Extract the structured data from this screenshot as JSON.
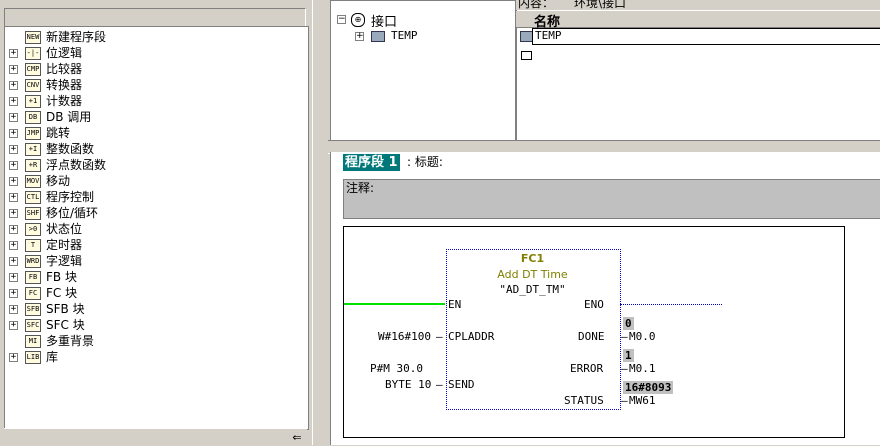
{
  "tree": {
    "items": [
      {
        "label": "新建程序段",
        "icon": "new-network-icon",
        "glyph": "NEW",
        "expandable": false
      },
      {
        "label": "位逻辑",
        "icon": "bit-logic-icon",
        "glyph": "-|-",
        "expandable": true
      },
      {
        "label": "比较器",
        "icon": "comparator-icon",
        "glyph": "CMP",
        "expandable": true
      },
      {
        "label": "转换器",
        "icon": "converter-icon",
        "glyph": "CNV",
        "expandable": true
      },
      {
        "label": "计数器",
        "icon": "counter-icon",
        "glyph": "+1",
        "expandable": true
      },
      {
        "label": "DB 调用",
        "icon": "db-call-icon",
        "glyph": "DB",
        "expandable": true
      },
      {
        "label": "跳转",
        "icon": "jump-icon",
        "glyph": "JMP",
        "expandable": true
      },
      {
        "label": "整数函数",
        "icon": "integer-math-icon",
        "glyph": "+I",
        "expandable": true
      },
      {
        "label": "浮点数函数",
        "icon": "float-math-icon",
        "glyph": "+R",
        "expandable": true
      },
      {
        "label": "移动",
        "icon": "move-icon",
        "glyph": "MOV",
        "expandable": true
      },
      {
        "label": "程序控制",
        "icon": "program-control-icon",
        "glyph": "CTL",
        "expandable": true
      },
      {
        "label": "移位/循环",
        "icon": "shift-rotate-icon",
        "glyph": "SHF",
        "expandable": true
      },
      {
        "label": "状态位",
        "icon": "status-bits-icon",
        "glyph": ">0",
        "expandable": true
      },
      {
        "label": "定时器",
        "icon": "timer-icon",
        "glyph": "T",
        "expandable": true
      },
      {
        "label": "字逻辑",
        "icon": "word-logic-icon",
        "glyph": "WRD",
        "expandable": true
      },
      {
        "label": "FB 块",
        "icon": "fb-block-icon",
        "glyph": "FB",
        "expandable": true
      },
      {
        "label": "FC 块",
        "icon": "fc-block-icon",
        "glyph": "FC",
        "expandable": true
      },
      {
        "label": "SFB 块",
        "icon": "sfb-block-icon",
        "glyph": "SFB",
        "expandable": true
      },
      {
        "label": "SFC 块",
        "icon": "sfc-block-icon",
        "glyph": "SFC",
        "expandable": true
      },
      {
        "label": "多重背景",
        "icon": "multi-instance-icon",
        "glyph": "MI",
        "expandable": false
      },
      {
        "label": "库",
        "icon": "library-icon",
        "glyph": "LIB",
        "expandable": true
      }
    ]
  },
  "interface": {
    "root_label": "接口",
    "child_label": "TEMP",
    "content_label": "内容：",
    "content_value": "环境\\接口",
    "col_name": "名称",
    "row_temp": "TEMP"
  },
  "network": {
    "label": "程序段 1",
    "title_label": ": 标题:",
    "comment_label": "注释:"
  },
  "block": {
    "name": "FC1",
    "desc": "Add DT Time",
    "symbol": "\"AD_DT_TM\"",
    "pins_left": [
      "EN",
      "CPLADDR",
      "SEND"
    ],
    "pins_right": [
      "ENO",
      "DONE",
      "ERROR",
      "STATUS"
    ],
    "cpladdr_param": "W#16#100",
    "send_ptr": "P#M 30.0",
    "send_len": "BYTE 10",
    "done_value": "0",
    "done_op": "M0.0",
    "error_value": "1",
    "error_op": "M0.1",
    "status_value": "16#8093",
    "status_op": "MW61"
  },
  "colors": {
    "accent": "#00787a",
    "power_flow": "#00e000",
    "frame": "#0000c0"
  },
  "scroll_glyph": "⇐"
}
